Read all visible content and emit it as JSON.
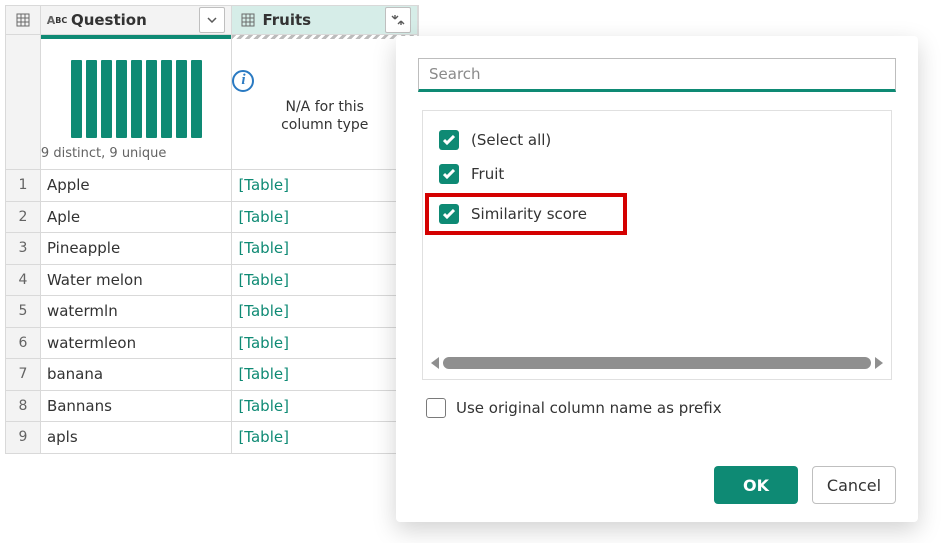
{
  "columns": {
    "question": {
      "label": "Question",
      "stat": "9 distinct, 9 unique"
    },
    "fruits": {
      "label": "Fruits",
      "na_text": "N/A for this\ncolumn type"
    }
  },
  "rows": [
    {
      "n": "1",
      "question": "Apple",
      "fruits": "[Table]"
    },
    {
      "n": "2",
      "question": "Aple",
      "fruits": "[Table]"
    },
    {
      "n": "3",
      "question": "Pineapple",
      "fruits": "[Table]"
    },
    {
      "n": "4",
      "question": "Water melon",
      "fruits": "[Table]"
    },
    {
      "n": "5",
      "question": "watermln",
      "fruits": "[Table]"
    },
    {
      "n": "6",
      "question": "watermleon",
      "fruits": "[Table]"
    },
    {
      "n": "7",
      "question": "banana",
      "fruits": "[Table]"
    },
    {
      "n": "8",
      "question": "Bannans",
      "fruits": "[Table]"
    },
    {
      "n": "9",
      "question": "apls",
      "fruits": "[Table]"
    }
  ],
  "panel": {
    "search_placeholder": "Search",
    "options": {
      "select_all": "(Select all)",
      "fruit": "Fruit",
      "similarity": "Similarity score"
    },
    "prefix_label": "Use original column name as prefix",
    "ok": "OK",
    "cancel": "Cancel"
  }
}
